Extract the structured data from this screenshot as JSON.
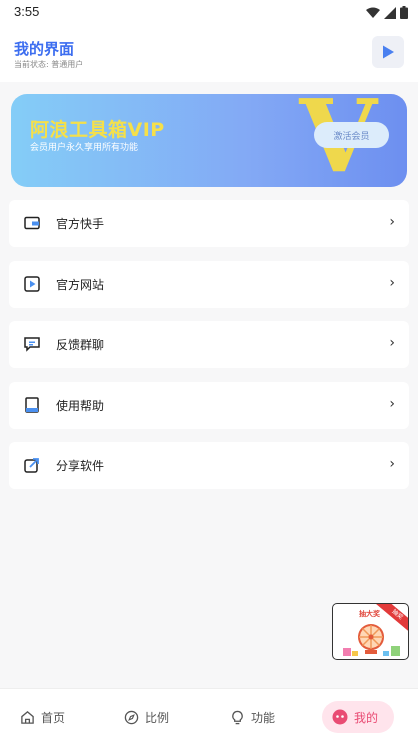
{
  "status_bar": {
    "time": "3:55"
  },
  "header": {
    "title": "我的界面",
    "user_status": "当前状态: 普通用户"
  },
  "vip_banner": {
    "title": "阿浪工具箱VIP",
    "subtitle": "会员用户永久享用所有功能",
    "button": "激活会员",
    "badge": "V"
  },
  "menu": [
    {
      "label": "官方快手",
      "icon": "wallet-icon"
    },
    {
      "label": "官方网站",
      "icon": "play-square-icon"
    },
    {
      "label": "反馈群聊",
      "icon": "chat-icon"
    },
    {
      "label": "使用帮助",
      "icon": "book-icon"
    },
    {
      "label": "分享软件",
      "icon": "share-icon"
    }
  ],
  "lucky_widget": {
    "title": "抽大奖",
    "ribbon": "抽奖"
  },
  "tabs": [
    {
      "label": "首页",
      "icon": "home-icon",
      "active": false
    },
    {
      "label": "比例",
      "icon": "compass-icon",
      "active": false
    },
    {
      "label": "功能",
      "icon": "bulb-icon",
      "active": false
    },
    {
      "label": "我的",
      "icon": "user-icon",
      "active": true
    }
  ],
  "colors": {
    "accent": "#3d6ef0",
    "active_tab": "#e94b73",
    "vip_gold": "#f5e04a"
  }
}
